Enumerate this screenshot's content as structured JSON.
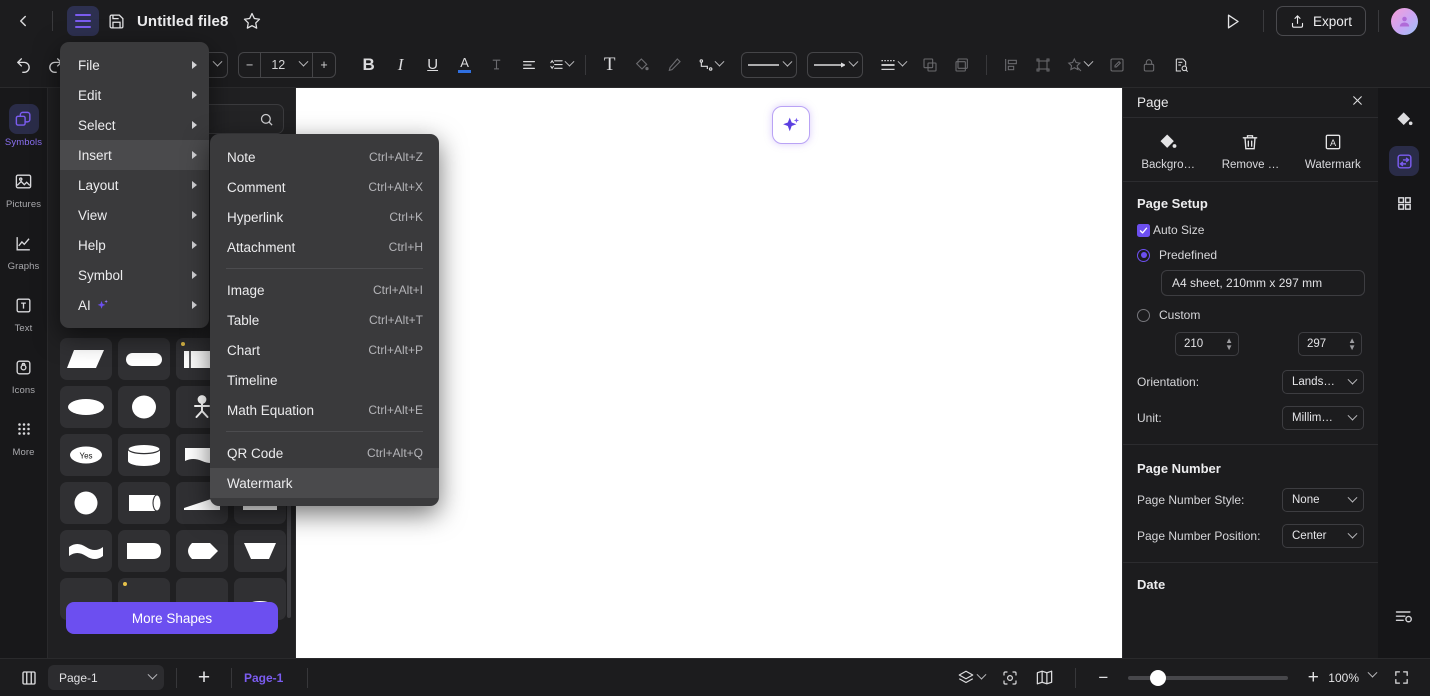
{
  "titlebar": {
    "back_icon": "chevron-left-icon",
    "menu_icon": "hamburger-menu-icon",
    "save_icon": "save-disk-icon",
    "title": "Untitled file8",
    "star_icon": "star-favorite-icon",
    "play_icon": "present-play-icon",
    "export_label": "Export",
    "export_icon": "share-upload-icon",
    "avatar_icon": "user-avatar-icon"
  },
  "toolbar": {
    "font_family_value": "",
    "font_size_value": "12",
    "decrease_label": "−",
    "increase_label": "+",
    "items": [
      {
        "name": "bold-button",
        "glyph": "B"
      },
      {
        "name": "italic-button",
        "glyph": "I"
      },
      {
        "name": "underline-button",
        "glyph": "U"
      },
      {
        "name": "font-color-button",
        "glyph": "A"
      },
      {
        "name": "strikethrough-button",
        "glyph": "T"
      },
      {
        "name": "align-button",
        "glyph": "≡"
      },
      {
        "name": "line-spacing-button",
        "glyph": "☰"
      },
      {
        "name": "text-box-button",
        "glyph": "T"
      },
      {
        "name": "fill-color-button",
        "glyph": "fill"
      },
      {
        "name": "brush-button",
        "glyph": "brush"
      },
      {
        "name": "connector-button",
        "glyph": "connector"
      }
    ],
    "line_style_icon": "line-style-preview",
    "arrow_style_icon": "arrow-style-preview",
    "line_weight_icon": "line-weight-preview"
  },
  "left_rail": {
    "items": [
      {
        "label": "Symbols",
        "icon": "symbols-icon",
        "active": true
      },
      {
        "label": "Pictures",
        "icon": "pictures-icon",
        "active": false
      },
      {
        "label": "Graphs",
        "icon": "graphs-icon",
        "active": false
      },
      {
        "label": "Text",
        "icon": "text-icon",
        "active": false
      },
      {
        "label": "Icons",
        "icon": "icons-icon",
        "active": false
      },
      {
        "label": "More",
        "icon": "more-grid-icon",
        "active": false
      }
    ]
  },
  "shapes_panel": {
    "search_icon": "search-icon",
    "search_placeholder": "",
    "more_shapes_label": "More Shapes"
  },
  "canvas": {
    "ai_button_icon": "ai-sparkle-icon"
  },
  "menu": {
    "main_items": [
      {
        "label": "File",
        "has_arrow": true,
        "highlight": false
      },
      {
        "label": "Edit",
        "has_arrow": true,
        "highlight": false
      },
      {
        "label": "Select",
        "has_arrow": true,
        "highlight": false
      },
      {
        "label": "Insert",
        "has_arrow": true,
        "highlight": true
      },
      {
        "label": "Layout",
        "has_arrow": true,
        "highlight": false
      },
      {
        "label": "View",
        "has_arrow": true,
        "highlight": false
      },
      {
        "label": "Help",
        "has_arrow": true,
        "highlight": false
      },
      {
        "label": "Symbol",
        "has_arrow": true,
        "highlight": false
      },
      {
        "label": "AI",
        "has_arrow": true,
        "highlight": false,
        "sparkle": true
      }
    ],
    "submenu_items": [
      {
        "label": "Note",
        "shortcut": "Ctrl+Alt+Z",
        "highlight": false
      },
      {
        "label": "Comment",
        "shortcut": "Ctrl+Alt+X",
        "highlight": false
      },
      {
        "label": "Hyperlink",
        "shortcut": "Ctrl+K",
        "highlight": false
      },
      {
        "label": "Attachment",
        "shortcut": "Ctrl+H",
        "highlight": false
      },
      {
        "divider": true
      },
      {
        "label": "Image",
        "shortcut": "Ctrl+Alt+I",
        "highlight": false
      },
      {
        "label": "Table",
        "shortcut": "Ctrl+Alt+T",
        "highlight": false
      },
      {
        "label": "Chart",
        "shortcut": "Ctrl+Alt+P",
        "highlight": false
      },
      {
        "label": "Timeline",
        "shortcut": "",
        "highlight": false
      },
      {
        "label": "Math Equation",
        "shortcut": "Ctrl+Alt+E",
        "highlight": false
      },
      {
        "divider": true
      },
      {
        "label": "QR Code",
        "shortcut": "Ctrl+Alt+Q",
        "highlight": false
      },
      {
        "label": "Watermark",
        "shortcut": "",
        "highlight": true
      }
    ]
  },
  "right_panel": {
    "title": "Page",
    "close_icon": "close-icon",
    "quick_actions": [
      {
        "label": "Backgro…",
        "icon": "paint-bucket-icon"
      },
      {
        "label": "Remove …",
        "icon": "trash-icon"
      },
      {
        "label": "Watermark",
        "icon": "watermark-a-icon"
      }
    ],
    "page_setup": {
      "title": "Page Setup",
      "auto_size_label": "Auto Size",
      "auto_size_checked": true,
      "predefined_label": "Predefined",
      "predefined_selected": true,
      "predefined_value": "A4 sheet, 210mm x 297 mm",
      "custom_label": "Custom",
      "custom_selected": false,
      "width_value": "210",
      "height_value": "297",
      "orientation_label": "Orientation:",
      "orientation_value": "Lands…",
      "unit_label": "Unit:",
      "unit_value": "Millim…"
    },
    "page_number": {
      "title": "Page Number",
      "style_label": "Page Number Style:",
      "style_value": "None",
      "position_label": "Page Number Position:",
      "position_value": "Center"
    },
    "date": {
      "title": "Date"
    }
  },
  "right_rail": {
    "items": [
      {
        "icon": "paint-bucket-icon",
        "active": false
      },
      {
        "icon": "page-properties-icon",
        "active": true
      },
      {
        "icon": "grid-apps-icon",
        "active": false
      }
    ],
    "bottom_icon": "layout-settings-icon"
  },
  "status_bar": {
    "panel_toggle_icon": "panel-toggle-icon",
    "page_select_value": "Page-1",
    "add_page_label": "+",
    "active_tab_label": "Page-1",
    "layers_icon": "layers-icon",
    "focus_icon": "focus-icon",
    "map_icon": "map-overview-icon",
    "zoom_out_label": "−",
    "zoom_in_label": "+",
    "zoom_value": "100%",
    "fullscreen_icon": "fullscreen-icon"
  },
  "colors": {
    "accent": "#6c4ff0",
    "background": "#1c1c1e",
    "panel": "#202022",
    "menu": "#3a3a3c",
    "canvas": "#ffffff"
  }
}
